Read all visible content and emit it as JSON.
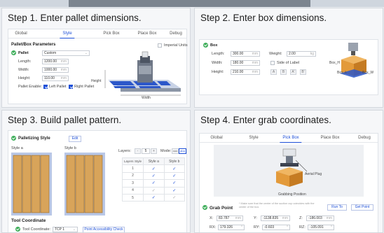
{
  "steps": {
    "step1": {
      "title": "Step 1. Enter pallet dimensions.",
      "tabs": [
        "Global",
        "Style",
        "Pick Box",
        "Place Box",
        "Debug"
      ],
      "active_tab": "Style",
      "section": "Pallet/Box Parameters",
      "imperial_units": "Imperial Units",
      "pallet_label": "Pallet",
      "pallet_select": "Custom",
      "length_label": "Length:",
      "length_value": "1200.00",
      "width_label": "Width:",
      "width_value": "1000.00",
      "height_label": "Height:",
      "height_value": "110.00",
      "unit": "mm",
      "pallet_enable_label": "Pallet Enable:",
      "left_pallet": "Left Pallet",
      "right_pallet": "Right Pallet",
      "img_height": "Height",
      "img_width": "Width"
    },
    "step2": {
      "title": "Step 2. Enter box dimensions.",
      "box_label": "Box",
      "length_label": "Length:",
      "length_value": "300.00",
      "width_label": "Width:",
      "width_value": "180.00",
      "height_label": "Height:",
      "height_value": "210.00",
      "unit": "mm",
      "weight_label": "Weight:",
      "weight_value": "2.00",
      "weight_unit": "kg",
      "side_of_label": "Side of Label",
      "label_buttons": [
        "A",
        "B",
        "A'",
        "B'"
      ],
      "box_h": "Box_H",
      "box_l": "Box_L",
      "box_w": "Box_W"
    },
    "step3": {
      "title": "Step 3. Build pallet pattern.",
      "palletizing_style": "Palletizing Style",
      "edit": "Edit",
      "style_a": "Style a",
      "style_b": "Style b",
      "layers_label": "Layers:",
      "layers_value": "5",
      "minus": "-",
      "plus": "+",
      "mode_label": "Mode:",
      "mode_a": "aaa",
      "mode_b": "aba",
      "table_headers": [
        "Layers",
        "Style",
        "Style a",
        "Style b"
      ],
      "table_rows": [
        {
          "layer": "1",
          "a": "✓",
          "b": "✓"
        },
        {
          "layer": "2",
          "a": "✓",
          "b": "✓"
        },
        {
          "layer": "3",
          "a": "✓",
          "b": "✓"
        },
        {
          "layer": "4",
          "a": "✓",
          "b": "✓"
        },
        {
          "layer": "5",
          "a": "✓",
          "b": "✓"
        }
      ],
      "tool_coordinate_title": "Tool Coordinate",
      "tool_coordinate_label": "Tool Coordinate:",
      "tool_coordinate_value": "TCP 1",
      "accessibility_button": "Point Accessibility Check"
    },
    "step4": {
      "title": "Step 4. Enter grab coordinates.",
      "tabs": [
        "Global",
        "Style",
        "Pick Box",
        "Place Box",
        "Debug"
      ],
      "active_tab": "Pick Box",
      "aerial_plug": "Aerial Plug",
      "grabbing_position": "Grabbing Position",
      "grab_point": "Grab Point",
      "note": "* Make sure that the center of the suction cup coincides with the center of the box.",
      "run_to": "Run To",
      "get_point": "Get Point",
      "x_label": "X:",
      "x_value": "83.787",
      "y_label": "Y:",
      "y_value": "-1138.835",
      "z_label": "Z:",
      "z_value": "-186.003",
      "rx_label": "RX:",
      "rx_value": "179.326",
      "ry_label": "RY:",
      "ry_value": "-0.603",
      "rz_label": "RZ:",
      "rz_value": "-105.091",
      "unit_mm": "mm",
      "unit_deg": "°"
    }
  },
  "colors": {
    "accent": "#1d4fd8",
    "status_green": "#3fae5b",
    "box_orange": "#e39a3a",
    "pallet_blue": "#2c57c9"
  }
}
